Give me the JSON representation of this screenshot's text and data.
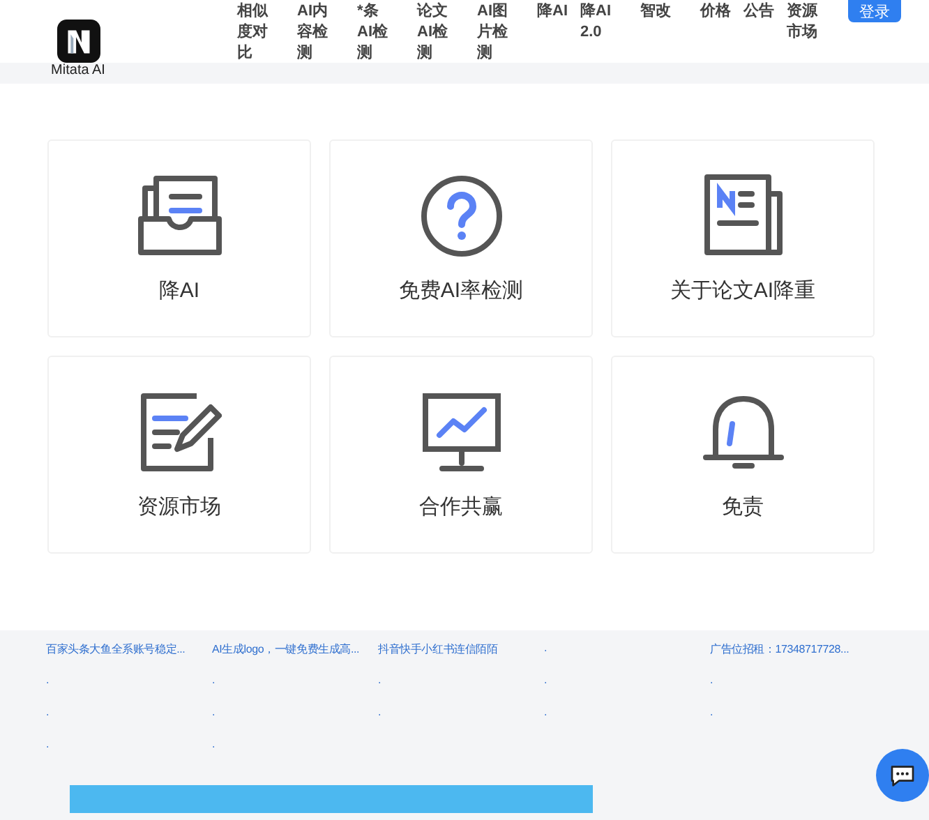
{
  "logo": {
    "text": "Mitata AI"
  },
  "nav": [
    {
      "label": "相似度对比"
    },
    {
      "label": "AI内容检测"
    },
    {
      "label": "*条AI检测"
    },
    {
      "label": "论文AI检测"
    },
    {
      "label": "AI图片检测"
    },
    {
      "label": "降AI"
    },
    {
      "label": "降AI2.0"
    },
    {
      "label": "智改"
    },
    {
      "label": "价格"
    },
    {
      "label": "公告"
    },
    {
      "label": "资源市场"
    }
  ],
  "login": "登录",
  "cards": [
    {
      "kind": "tray",
      "title": "降AI"
    },
    {
      "kind": "question",
      "title": "免费AI率检测"
    },
    {
      "kind": "news",
      "title": "关于论文AI降重"
    },
    {
      "kind": "edit",
      "title": "资源市场"
    },
    {
      "kind": "chart",
      "title": "合作共赢"
    },
    {
      "kind": "bell",
      "title": "免责"
    }
  ],
  "footer_links": [
    [
      "百家头条大鱼全系账号稳定...",
      "AI生成logo，一键免费生成高...",
      "抖音快手小红书连信陌陌",
      ".",
      "广告位招租：17348717728..."
    ],
    [
      ".",
      ".",
      ".",
      ".",
      "."
    ],
    [
      ".",
      ".",
      ".",
      ".",
      "."
    ],
    [
      ".",
      "."
    ]
  ]
}
